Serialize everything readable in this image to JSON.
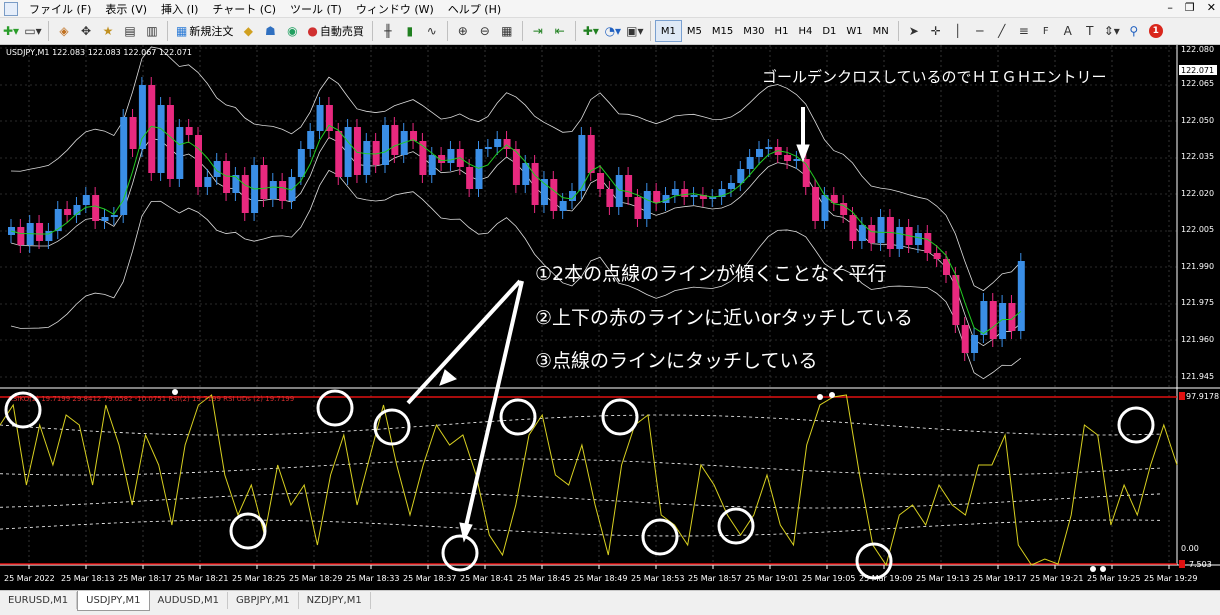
{
  "menubar": {
    "items": [
      "ファイル (F)",
      "表示 (V)",
      "挿入 (I)",
      "チャート (C)",
      "ツール (T)",
      "ウィンドウ (W)",
      "ヘルプ (H)"
    ]
  },
  "toolbar": {
    "new_order_label": "新規注文",
    "auto_trade_label": "自動売買",
    "timeframes": [
      "M1",
      "M5",
      "M15",
      "M30",
      "H1",
      "H4",
      "D1",
      "W1",
      "MN"
    ],
    "active_timeframe": "M1",
    "notification_count": "1"
  },
  "chart": {
    "symbol_info": "USDJPY,M1  122.083 122.083 122.067 122.071",
    "current_price": "122.071",
    "price_labels": [
      "122.080",
      "122.065",
      "122.050",
      "122.035",
      "122.020",
      "122.005",
      "121.990",
      "121.975",
      "121.960",
      "121.945"
    ],
    "indicator_scale": [
      "97.9178",
      "0.00",
      "-7.503"
    ],
    "indicator_info": "RSIKO(2) 19.7199 29.8412 79.0582 -10.0751 RSI(2) 19.7199 RSI UDs (2) 19.7199",
    "time_labels": [
      "25 Mar 2022",
      "25 Mar 18:13",
      "25 Mar 18:17",
      "25 Mar 18:21",
      "25 Mar 18:25",
      "25 Mar 18:29",
      "25 Mar 18:33",
      "25 Mar 18:37",
      "25 Mar 18:41",
      "25 Mar 18:45",
      "25 Mar 18:49",
      "25 Mar 18:53",
      "25 Mar 18:57",
      "25 Mar 19:01",
      "25 Mar 19:05",
      "25 Mar 19:09",
      "25 Mar 19:13",
      "25 Mar 19:17",
      "25 Mar 19:21",
      "25 Mar 19:25",
      "25 Mar 19:29"
    ],
    "annotations": {
      "golden_cross": "ゴールデンクロスしているのでＨＩＧＨエントリー",
      "note1": "①2本の点線のラインが傾くことなく平行",
      "note2": "②上下の赤のラインに近いorタッチしている",
      "note3": "③点線のラインにタッチしている"
    },
    "colors": {
      "bull": "#3a8ee6",
      "bear": "#e8297f",
      "ma": "#22cc22",
      "band": "#dcdcdc",
      "rsi": "#d8d020",
      "level": "#e01010"
    }
  },
  "tabs": [
    "EURUSD,M1",
    "USDJPY,M1",
    "AUDUSD,M1",
    "GBPJPY,M1",
    "NZDJPY,M1"
  ],
  "active_tab": "USDJPY,M1"
}
